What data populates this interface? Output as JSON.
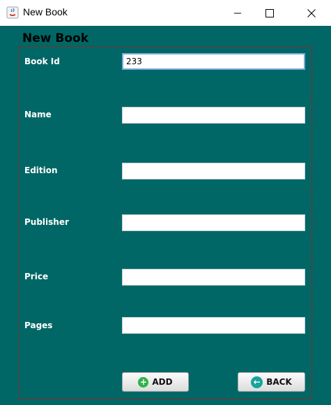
{
  "window": {
    "title": "New Book",
    "controls": {
      "minimize_icon": "minimize-icon",
      "maximize_icon": "maximize-icon",
      "close_icon": "close-icon"
    }
  },
  "form": {
    "heading": "New Book",
    "fields": [
      {
        "label": "Book Id",
        "value": "233"
      },
      {
        "label": "Name",
        "value": ""
      },
      {
        "label": "Edition",
        "value": ""
      },
      {
        "label": "Publisher",
        "value": ""
      },
      {
        "label": "Price",
        "value": ""
      },
      {
        "label": "Pages",
        "value": ""
      }
    ],
    "buttons": {
      "add": {
        "label": "ADD",
        "icon": "plus-circle-icon"
      },
      "back": {
        "label": "BACK",
        "icon": "back-arrow-icon"
      }
    }
  },
  "colors": {
    "background": "#006766",
    "panel_border": "#7a2e2e",
    "label_text": "#ffffff",
    "add_icon": "#2fb34a",
    "back_icon": "#18a39c"
  }
}
